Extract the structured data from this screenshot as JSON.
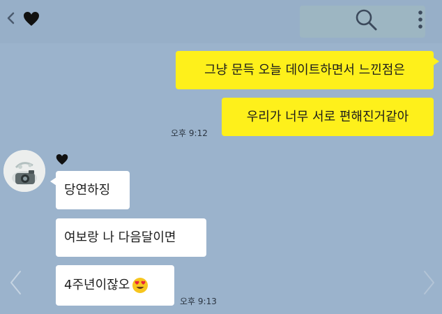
{
  "header": {
    "back_icon": "chevron-left-icon",
    "contact_icon": "black-heart-icon",
    "search_icon": "search-icon",
    "menu_icon": "more-vertical-icon"
  },
  "messages": {
    "sent": [
      {
        "text": "그냥 문득 오늘 데이트하면서 느낀점은"
      },
      {
        "text": "우리가 너무 서로 편해진거같아"
      }
    ],
    "sent_time": "오후 9:12",
    "sender_name_icon": "black-heart-icon",
    "received": [
      {
        "text": "당연하징"
      },
      {
        "text": "여보랑 나 다음달이면"
      },
      {
        "text": "4주년이잖오",
        "emoji": "heart-eyes-emoji"
      }
    ],
    "received_time": "오후 9:13"
  },
  "colors": {
    "background": "#9bb3cc",
    "sent_bubble": "#fef01b",
    "received_bubble": "#ffffff"
  }
}
